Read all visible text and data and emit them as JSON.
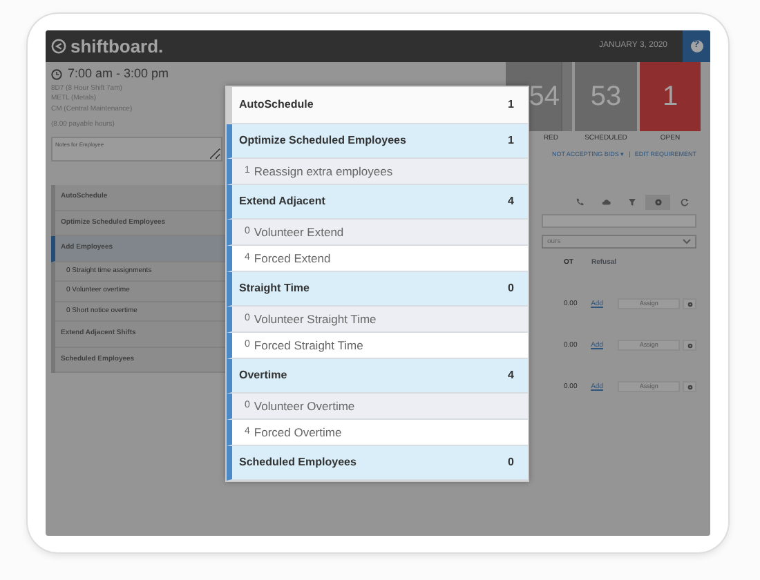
{
  "header": {
    "logo": "shiftboard.",
    "date": "JANUARY 3, 2020",
    "help": "?"
  },
  "shift": {
    "time": "7:00 am - 3:00 pm",
    "details": [
      "8D7 (8 Hour Shift 7am)",
      "METL (Metals)",
      "CM (Central Maintenance)"
    ],
    "hours": "(8.00 payable hours)",
    "notes_placeholder": "Notes for Employee"
  },
  "menu": [
    {
      "label": "AutoSchedule",
      "selected": false
    },
    {
      "label": "Optimize Scheduled Employees",
      "selected": false
    },
    {
      "label": "Add Employees",
      "selected": true,
      "children": [
        {
          "label": "0 Straight time assignments"
        },
        {
          "label": "0 Volunteer overtime"
        },
        {
          "label": "0 Short notice overtime"
        }
      ]
    },
    {
      "label": "Extend Adjacent Shifts",
      "selected": false
    },
    {
      "label": "Scheduled Employees",
      "selected": false
    }
  ],
  "stats": [
    {
      "value": "54",
      "label": "RED",
      "kind": "spinner"
    },
    {
      "value": "53",
      "label": "SCHEDULED",
      "kind": "plain"
    },
    {
      "value": "1",
      "label": "OPEN",
      "kind": "alert"
    }
  ],
  "links": {
    "bids": "NOT ACCEPTING BIDS ▾",
    "separator": "|",
    "edit": "EDIT REQUIREMENT"
  },
  "toolbar": [
    {
      "kind": "phone",
      "selected": false
    },
    {
      "kind": "cloud",
      "selected": false
    },
    {
      "kind": "filter",
      "selected": false
    },
    {
      "kind": "gear",
      "selected": true
    },
    {
      "kind": "refresh",
      "selected": false
    }
  ],
  "select": {
    "value": "ours"
  },
  "table": {
    "columns": [
      "OT",
      "Refusal"
    ],
    "rows": [
      {
        "ot": "0.00",
        "refusal": "Add",
        "action": "Assign"
      },
      {
        "ot": "0.00",
        "refusal": "Add",
        "action": "Assign"
      },
      {
        "ot": "0.00",
        "refusal": "Add",
        "action": "Assign"
      }
    ]
  },
  "modal": {
    "rows": [
      {
        "kind": "header",
        "label": "AutoSchedule",
        "count": "1"
      },
      {
        "kind": "group",
        "label": "Optimize Scheduled Employees",
        "count": "1",
        "children": [
          {
            "count": "1",
            "label": "Reassign extra employees"
          }
        ]
      },
      {
        "kind": "group",
        "label": "Extend Adjacent",
        "count": "4",
        "children": [
          {
            "count": "0",
            "label": "Volunteer Extend"
          },
          {
            "count": "4",
            "label": "Forced Extend"
          }
        ]
      },
      {
        "kind": "group",
        "label": "Straight Time",
        "count": "0",
        "children": [
          {
            "count": "0",
            "label": "Volunteer Straight Time"
          },
          {
            "count": "0",
            "label": "Forced Straight Time"
          }
        ]
      },
      {
        "kind": "group",
        "label": "Overtime",
        "count": "4",
        "children": [
          {
            "count": "0",
            "label": "Volunteer Overtime"
          },
          {
            "count": "4",
            "label": "Forced Overtime"
          }
        ]
      },
      {
        "kind": "group",
        "label": "Scheduled Employees",
        "count": "0"
      }
    ]
  }
}
